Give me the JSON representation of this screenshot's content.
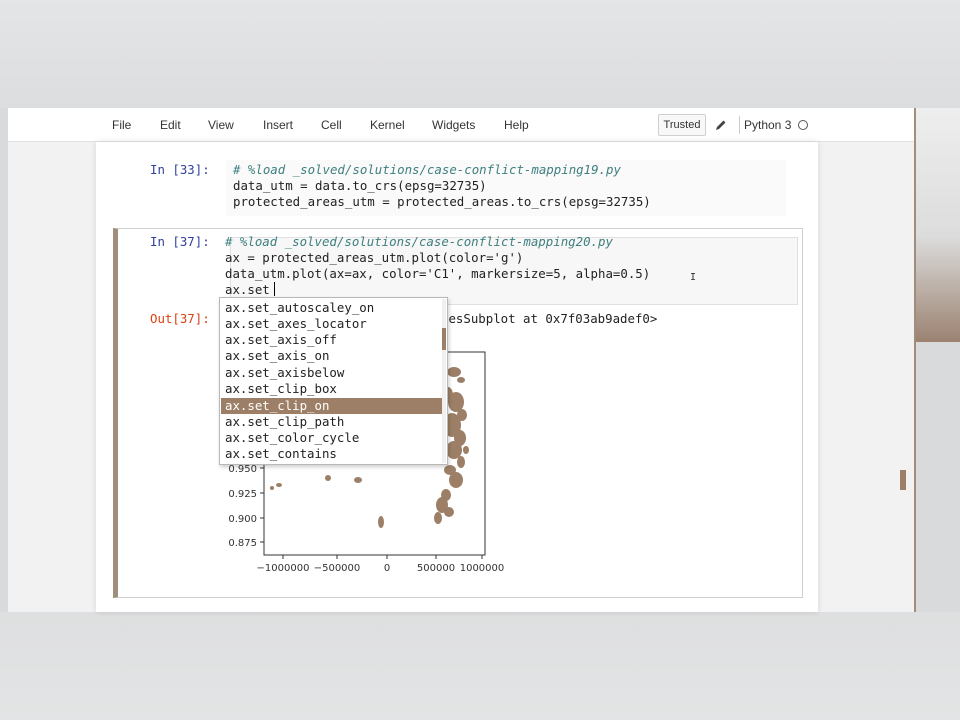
{
  "menu": {
    "items": [
      "File",
      "Edit",
      "View",
      "Insert",
      "Cell",
      "Kernel",
      "Widgets",
      "Help"
    ],
    "trusted_label": "Trusted",
    "kernel_name": "Python 3"
  },
  "cells": {
    "cell33": {
      "prompt": "In [33]:",
      "lines": [
        "# %load _solved/solutions/case-conflict-mapping19.py",
        "data_utm = data.to_crs(epsg=32735)",
        "protected_areas_utm = protected_areas.to_crs(epsg=32735)"
      ]
    },
    "cell37": {
      "prompt": "In [37]:",
      "lines": [
        "# %load _solved/solutions/case-conflict-mapping20.py",
        "ax = protected_areas_utm.plot(color='g')",
        "data_utm.plot(ax=ax, color='C1', markersize=5, alpha=0.5)",
        "ax.set"
      ],
      "out_prompt": "Out[37]:",
      "out_text_visible": "xesSubplot at 0x7f03ab9adef0>"
    }
  },
  "autocomplete": {
    "items": [
      "ax.set_autoscaley_on",
      "ax.set_axes_locator",
      "ax.set_axis_off",
      "ax.set_axis_on",
      "ax.set_axisbelow",
      "ax.set_clip_box",
      "ax.set_clip_on",
      "ax.set_clip_path",
      "ax.set_color_cycle",
      "ax.set_contains"
    ],
    "selected_index": 6
  },
  "chart_data": {
    "type": "scatter",
    "x_ticks": [
      "−1000000",
      "−500000",
      "0",
      "500000",
      "1000000"
    ],
    "y_ticks": [
      "0.950",
      "0.925",
      "0.900",
      "0.875"
    ],
    "color": "#9c7f66"
  },
  "colors": {
    "accent": "#a08d7b",
    "selection": "#9c7f66",
    "prompt_in": "#303f9f",
    "prompt_out": "#d84315"
  }
}
